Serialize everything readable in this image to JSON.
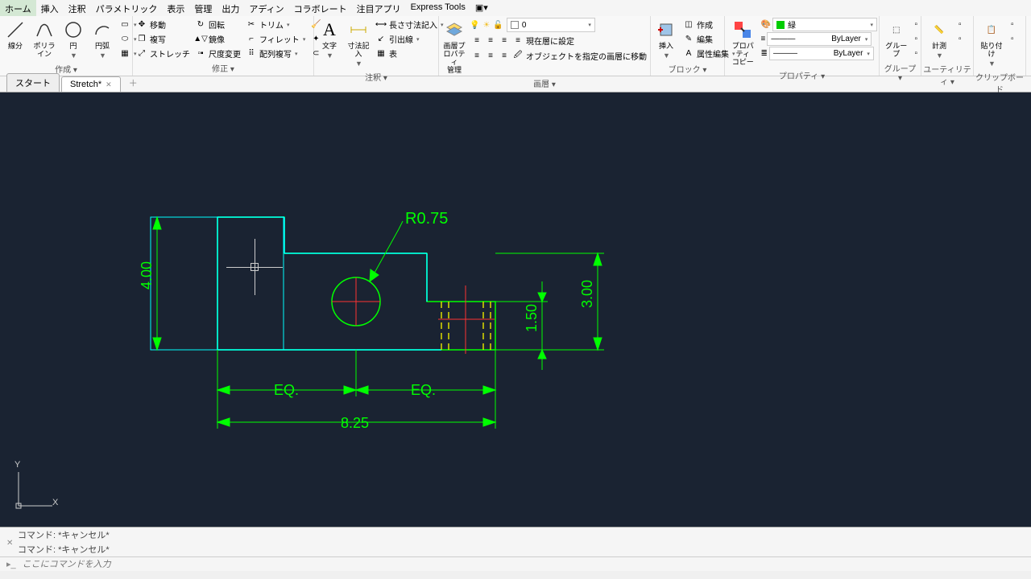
{
  "menu": {
    "items": [
      "ホーム",
      "挿入",
      "注釈",
      "パラメトリック",
      "表示",
      "管理",
      "出力",
      "アディン",
      "コラボレート",
      "注目アプリ",
      "Express Tools"
    ],
    "active": 0
  },
  "ribbon": {
    "draw": {
      "label": "作成 ▾",
      "line": "線分",
      "pline": "ポリライン",
      "circle": "円",
      "arc": "円弧"
    },
    "modify": {
      "label": "修正 ▾",
      "move": "移動",
      "rotate": "回転",
      "trim": "トリム",
      "copy": "複写",
      "mirror": "鏡像",
      "fillet": "フィレット",
      "stretch": "ストレッチ",
      "scale": "尺度変更",
      "array": "配列複写"
    },
    "annot": {
      "label": "注釈 ▾",
      "text": "文字",
      "dim": "寸法記入",
      "dimlen": "長さ寸法記入",
      "leader": "引出線",
      "table": "表"
    },
    "layers": {
      "label": "画層 ▾",
      "props": "画層プロパティ\n管理",
      "current": "0",
      "cur": "現在層に設定",
      "match": "オブジェクトを指定の画層に移動"
    },
    "block": {
      "label": "ブロック ▾",
      "insert": "挿入",
      "create": "作成",
      "edit": "編集",
      "attr": "属性編集"
    },
    "props": {
      "label": "プロパティ ▾",
      "match": "プロパティ\nコピー",
      "color": "緑",
      "bylayer": "ByLayer"
    },
    "group": {
      "label": "グループ ▾",
      "gr": "グループ"
    },
    "util": {
      "label": "ユーティリティ ▾",
      "meas": "計測"
    },
    "clip": {
      "label": "クリップボード",
      "paste": "貼り付け"
    }
  },
  "tabs": {
    "start": "スタート",
    "doc": "Stretch*"
  },
  "drawing": {
    "radius": "R0.75",
    "h4": "4.00",
    "h3": "3.00",
    "h15": "1.50",
    "w825": "8.25",
    "eq": "EQ."
  },
  "cmd": {
    "hist1": "コマンド:  *キャンセル*",
    "hist2": "コマンド:  *キャンセル*",
    "prompt": "ここにコマンドを入力"
  }
}
